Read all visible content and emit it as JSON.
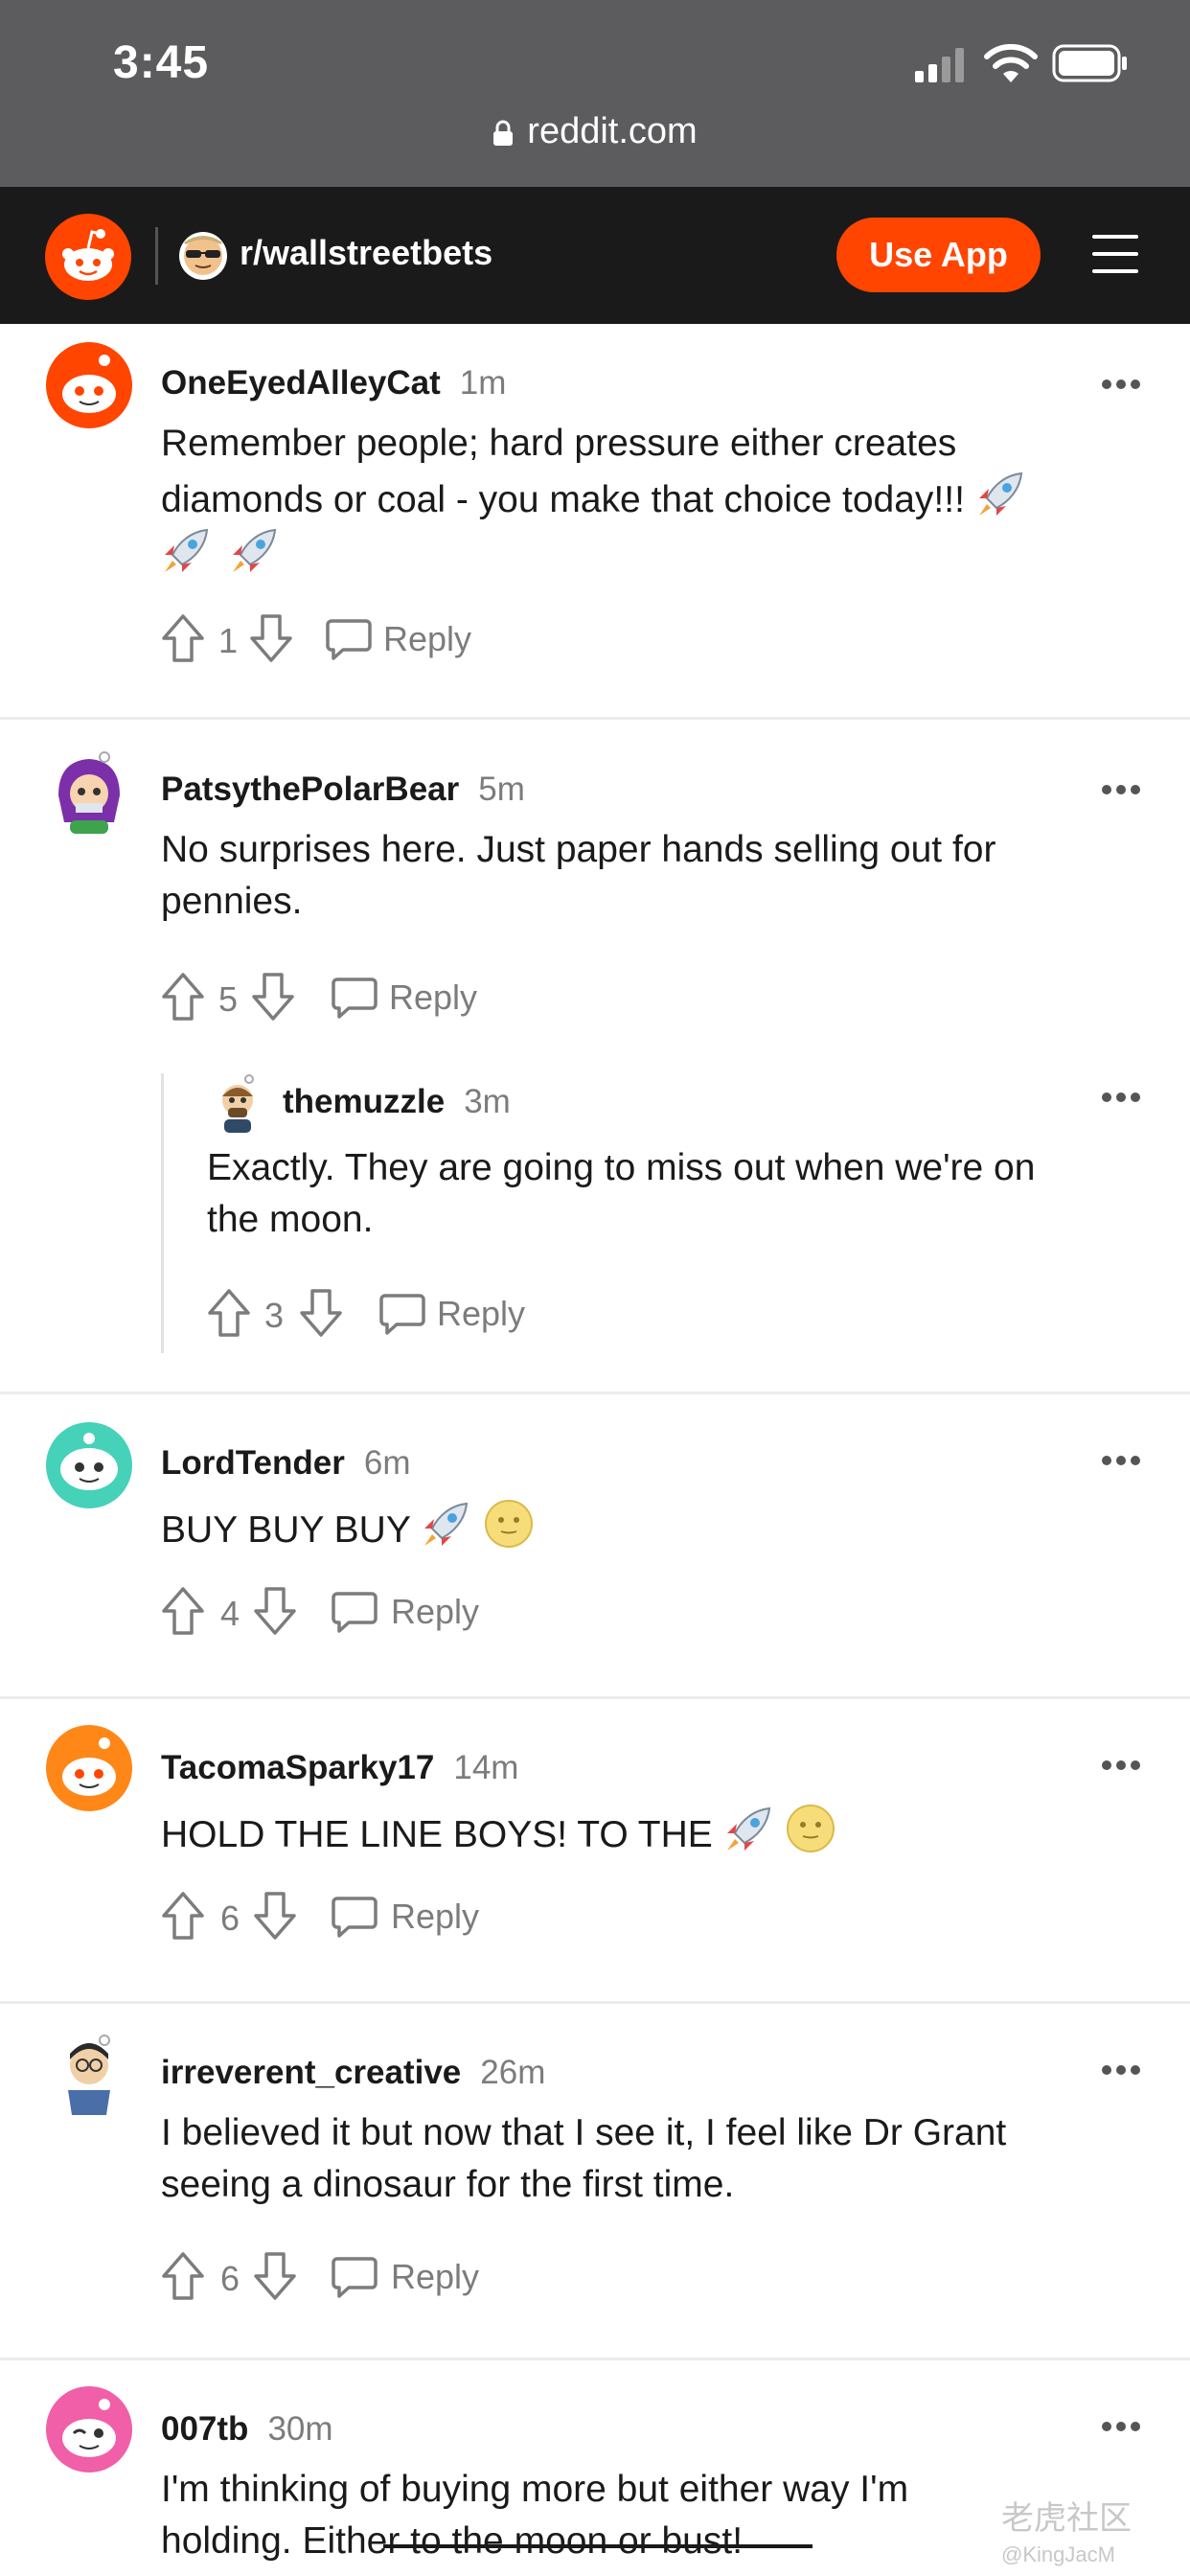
{
  "status_bar": {
    "time": "3:45",
    "url": "reddit.com"
  },
  "header": {
    "subreddit": "r/wallstreetbets",
    "use_app_label": "Use App"
  },
  "comments": [
    {
      "author": "OneEyedAlleyCat",
      "age": "1m",
      "text_line1": "Remember people; hard pressure either creates",
      "text_line2": "diamonds or coal - you make that choice today!!!",
      "emoji": [
        "rocket",
        "rocket",
        "rocket"
      ],
      "votes": "1",
      "reply_label": "Reply"
    },
    {
      "author": "PatsythePolarBear",
      "age": "5m",
      "text_line1": "No surprises here. Just paper hands selling out for",
      "text_line2": "pennies.",
      "votes": "5",
      "reply_label": "Reply",
      "replies": [
        {
          "author": "themuzzle",
          "age": "3m",
          "text_line1": "Exactly. They are going to miss out when we're on",
          "text_line2": "the moon.",
          "votes": "3",
          "reply_label": "Reply"
        }
      ]
    },
    {
      "author": "LordTender",
      "age": "6m",
      "text_line1": "BUY BUY BUY",
      "emoji": [
        "rocket",
        "moon"
      ],
      "votes": "4",
      "reply_label": "Reply"
    },
    {
      "author": "TacomaSparky17",
      "age": "14m",
      "text_line1": "HOLD THE LINE BOYS! TO THE",
      "emoji": [
        "rocket",
        "moon"
      ],
      "votes": "6",
      "reply_label": "Reply"
    },
    {
      "author": "irreverent_creative",
      "age": "26m",
      "text_line1": "I believed it but now that I see it, I feel like Dr Grant",
      "text_line2": "seeing a dinosaur for the first time.",
      "votes": "6",
      "reply_label": "Reply"
    },
    {
      "author": "007tb",
      "age": "30m",
      "text_line1": "I'm thinking of buying more but either way I'm",
      "text_line2": "holding. Either to the moon or bust!"
    }
  ],
  "watermark": {
    "line1": "老虎社区",
    "line2": "@KingJacM"
  },
  "colors": {
    "accent": "#ff4500",
    "header_bg": "#1a1a1b",
    "status_bg": "#5c5c5e",
    "meta_gray": "#7c7c7c"
  }
}
